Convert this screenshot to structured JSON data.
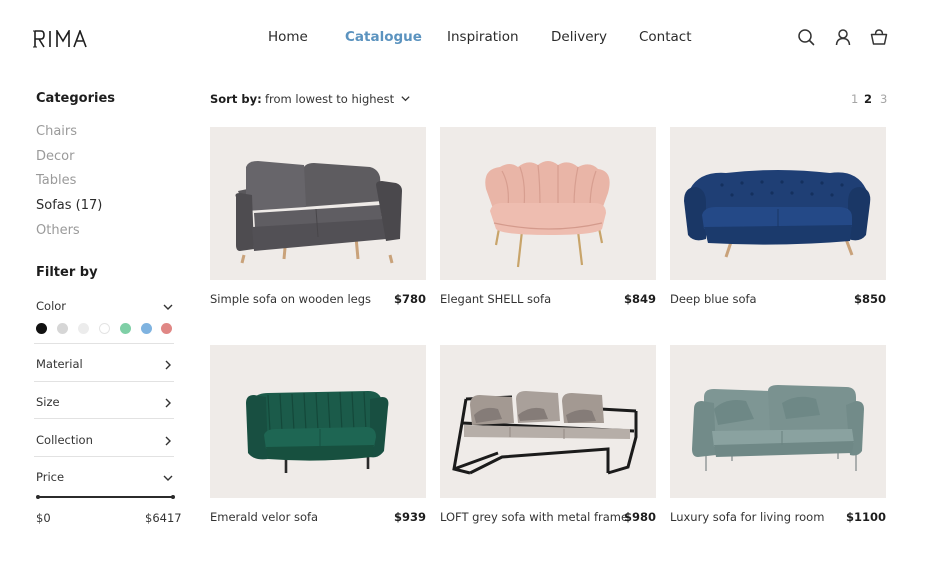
{
  "header": {
    "logo_text": "RIMA",
    "nav": [
      {
        "label": "Home"
      },
      {
        "label": "Catalogue",
        "active": true
      },
      {
        "label": "Inspiration"
      },
      {
        "label": "Delivery"
      },
      {
        "label": "Contact"
      }
    ],
    "icons": [
      "search-icon",
      "user-icon",
      "basket-icon"
    ]
  },
  "sidebar": {
    "categories_title": "Categories",
    "categories": [
      {
        "label": "Chairs"
      },
      {
        "label": "Decor"
      },
      {
        "label": "Tables"
      },
      {
        "label": "Sofas (17)",
        "active": true
      },
      {
        "label": "Others"
      }
    ],
    "filter_title": "Filter by",
    "filters": {
      "color": "Color",
      "material": "Material",
      "size": "Size",
      "collection": "Collection",
      "price": "Price"
    },
    "colors": [
      "#111111",
      "#d6d6d6",
      "#ececec",
      "#ffffff",
      "#7fcfa6",
      "#7fb3e0",
      "#e08785"
    ],
    "price_min": "$0",
    "price_max": "$6417"
  },
  "toolbar": {
    "sort_label": "Sort by:",
    "sort_value": "from lowest to highest",
    "pages": [
      "1",
      "2",
      "3"
    ],
    "current_page": "2"
  },
  "products": [
    {
      "name": "Simple sofa on wooden legs",
      "price": "$780"
    },
    {
      "name": "Elegant SHELL sofa",
      "price": "$849"
    },
    {
      "name": "Deep blue sofa",
      "price": "$850"
    },
    {
      "name": "Emerald velor sofa",
      "price": "$939"
    },
    {
      "name": "LOFT grey sofa with metal frame",
      "price": "$980"
    },
    {
      "name": "Luxury sofa for living room",
      "price": "$1100"
    }
  ],
  "colors": {
    "accent": "#5b93bf",
    "image_bg": "#efebe8"
  }
}
